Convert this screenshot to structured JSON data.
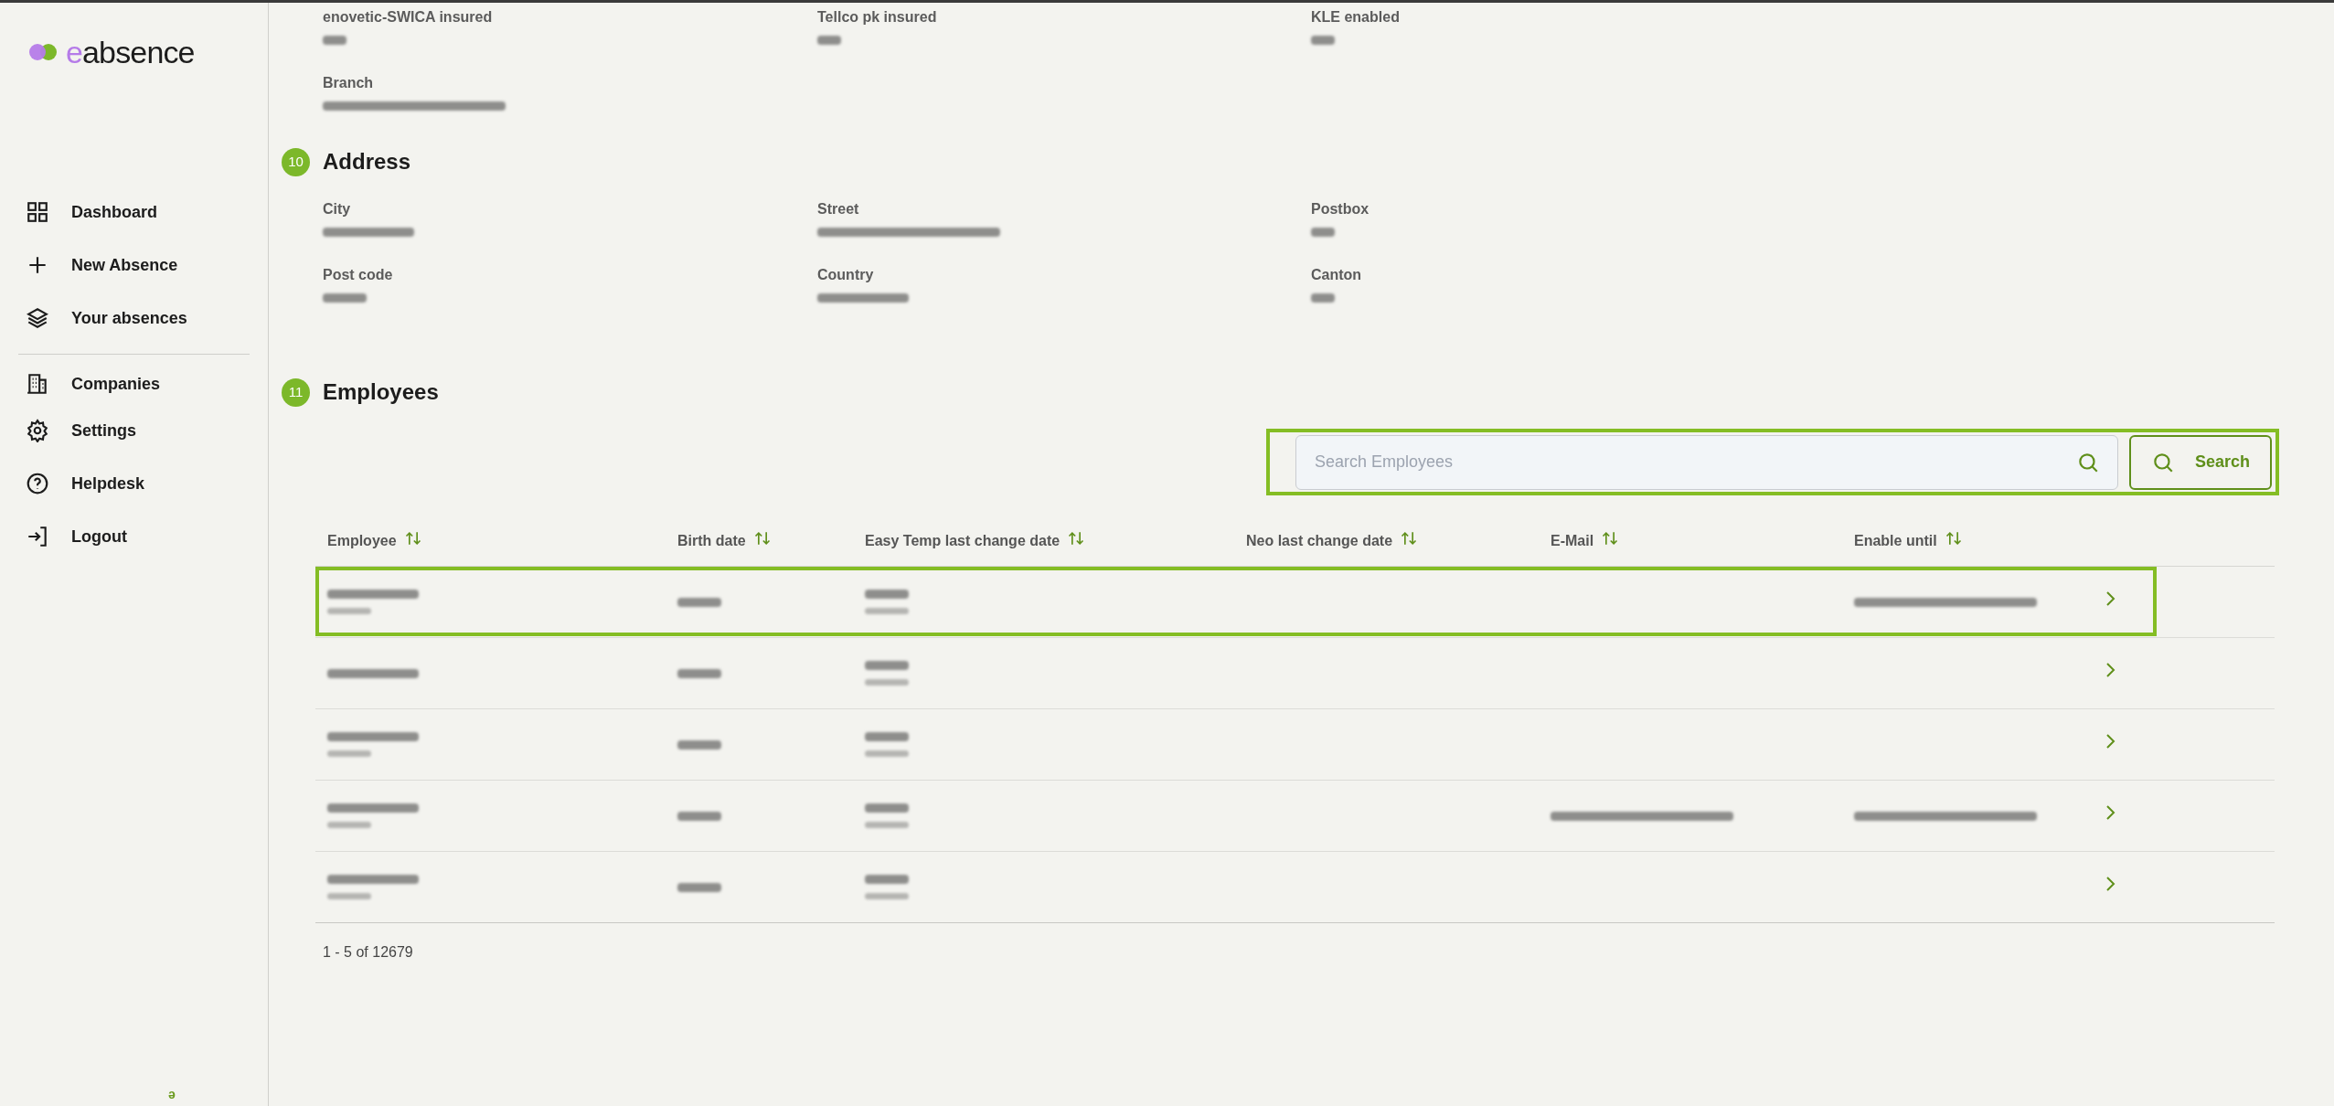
{
  "sidebar": {
    "logo": {
      "accent": "e",
      "rest": "absence"
    },
    "nav_groups": [
      [
        {
          "label": "Dashboard",
          "kind": "dashboard"
        },
        {
          "label": "New Absence",
          "kind": "plus"
        },
        {
          "label": "Your absences",
          "kind": "layers"
        }
      ],
      [
        {
          "label": "Companies",
          "kind": "building"
        },
        {
          "label": "Settings",
          "kind": "gear"
        },
        {
          "label": "Helpdesk",
          "kind": "help"
        },
        {
          "label": "Logout",
          "kind": "logout"
        }
      ]
    ],
    "footer_mark": "ə"
  },
  "sections": [
    {
      "fields": [
        [
          {
            "label": "enovetic-SWICA insured",
            "redacted": true
          },
          {
            "label": "Tellco pk insured",
            "redacted": true
          },
          {
            "label": "KLE enabled",
            "redacted": true
          }
        ],
        [
          {
            "label": "Branch",
            "redacted": true
          }
        ]
      ]
    },
    {
      "number": "10",
      "title": "Address",
      "fields": [
        [
          {
            "label": "City",
            "redacted": true
          },
          {
            "label": "Street",
            "redacted": true
          },
          {
            "label": "Postbox",
            "redacted": true
          }
        ],
        [
          {
            "label": "Post code",
            "redacted": true
          },
          {
            "label": "Country",
            "redacted": true
          },
          {
            "label": "Canton",
            "redacted": true
          }
        ]
      ]
    },
    {
      "number": "11",
      "title": "Employees"
    }
  ],
  "employees": {
    "search": {
      "placeholder": "Search Employees",
      "button": "Search"
    },
    "columns": [
      {
        "label": "Employee",
        "sortable": true
      },
      {
        "label": "Birth date",
        "sortable": true
      },
      {
        "label": "Easy Temp last change date",
        "sortable": true
      },
      {
        "label": "Neo last change date",
        "sortable": true
      },
      {
        "label": "E-Mail",
        "sortable": true
      },
      {
        "label": "Enable until",
        "sortable": true
      }
    ],
    "rows": [
      {
        "selected": true,
        "cells": {
          "employee": true,
          "employee_id": true,
          "birth_date": true,
          "easy_temp": true,
          "easy_temp_id": true,
          "enable_until": true
        }
      },
      {
        "selected": false,
        "cells": {
          "employee": true,
          "birth_date": true,
          "easy_temp": true,
          "easy_temp_id": true
        }
      },
      {
        "selected": false,
        "cells": {
          "employee": true,
          "employee_id": true,
          "birth_date": true,
          "easy_temp": true,
          "easy_temp_id": true
        }
      },
      {
        "selected": false,
        "cells": {
          "employee": true,
          "employee_id": true,
          "birth_date": true,
          "easy_temp": true,
          "easy_temp_id": true,
          "email": true,
          "enable_until": true
        }
      },
      {
        "selected": false,
        "cells": {
          "employee": true,
          "employee_id": true,
          "birth_date": true,
          "easy_temp": true,
          "easy_temp_id": true
        }
      }
    ],
    "pagination": "1 - 5 of 12679"
  }
}
